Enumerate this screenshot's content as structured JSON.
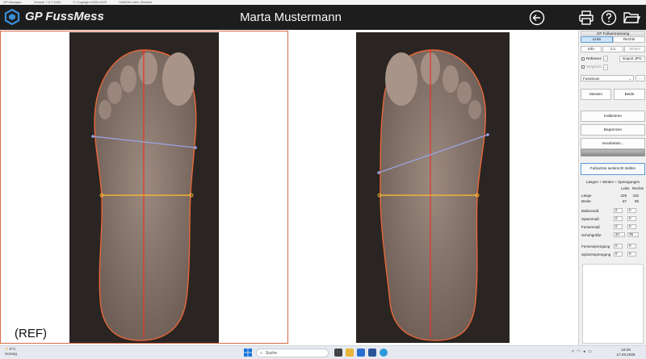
{
  "window": {
    "app_label": "GP-Manager",
    "version": "Version 7.3.7.0000",
    "copyright": "© Copyright 1996-2025",
    "company": "GeBiOM mbH, Münster"
  },
  "header": {
    "app_name": "GP FussMess",
    "patient_name": "Marta Mustermann",
    "icons": [
      "back-icon",
      "printer-icon",
      "help-icon",
      "folder-icon"
    ]
  },
  "canvas": {
    "ref_label": "(REF)",
    "colors": {
      "outline": "#e8673a",
      "axis": "#e03a2a",
      "width_line": "#f2b233",
      "diagonal": "#9aa3e0",
      "frame": "#d76a4a"
    }
  },
  "panel": {
    "title": "GP Fußvermessung",
    "side_left": "Links",
    "side_right": "Rechts",
    "info": "Info",
    "one_to_one": "1:1",
    "winkel": "Winkel",
    "referenz": "Referenz",
    "vergleich": "Vergleich",
    "ellipsis": "...",
    "export_jpg": "Export JPG",
    "scanner_select": "FussScan",
    "messen": "Messen",
    "beide": "Beide",
    "kalibrieren": "Kalibrieren",
    "begrenzen": "Begrenzen",
    "verarbeiten": "Verarbeiten...",
    "fussachse": "Fußachse senkrecht stellen",
    "section_title": "Längen + Weiten + Sprengungen",
    "col_links": "Links",
    "col_rechts": "Rechts",
    "rows": [
      {
        "label": "Länge",
        "links": "229",
        "rechts": "232"
      },
      {
        "label": "Breite",
        "links": "87",
        "rechts": "95"
      }
    ],
    "inputs": [
      {
        "label": "Ballenmaß",
        "links": "0",
        "rechts": "0"
      },
      {
        "label": "Spannmaß",
        "links": "0",
        "rechts": "0"
      },
      {
        "label": "Fersenmaß",
        "links": "0",
        "rechts": "0"
      },
      {
        "label": "Schuhgröße",
        "links": "34",
        "rechts": "35"
      }
    ],
    "sprengung": [
      {
        "label": "Fersensprengung",
        "links": "0",
        "rechts": "0"
      },
      {
        "label": "Spitzensprengung",
        "links": "0",
        "rechts": "0"
      }
    ]
  },
  "taskbar": {
    "temperature": "5°C",
    "weather": "Sonnig",
    "search_placeholder": "Suche",
    "time": "10:29",
    "date": "17.03.2025"
  }
}
